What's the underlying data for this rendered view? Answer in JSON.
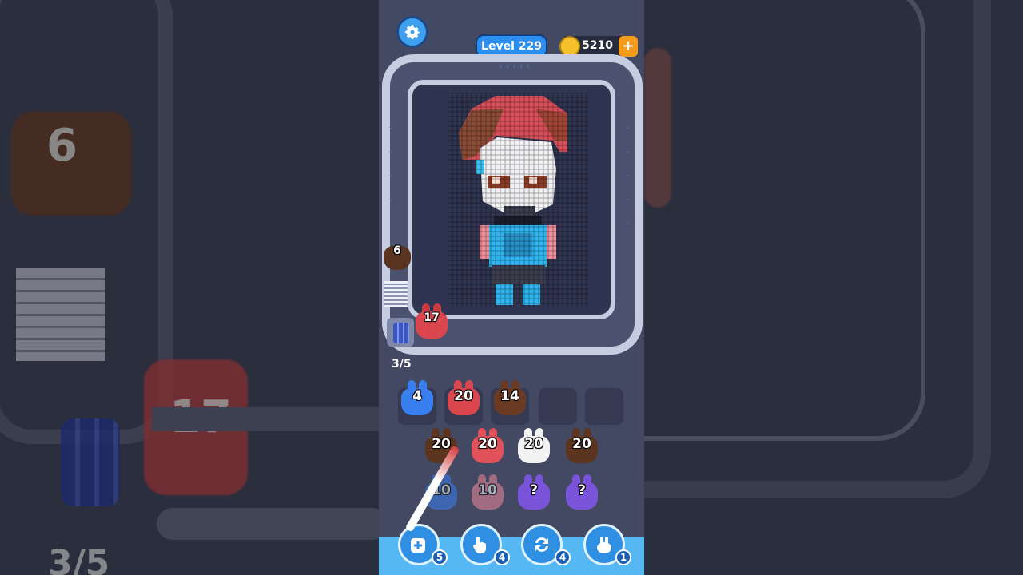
{
  "header": {
    "level_label": "Level 229",
    "coins": "5210",
    "coin_plus": "+"
  },
  "track": {
    "queue_item_count": "6",
    "active_item_count": "17",
    "slot_counter": "3/5"
  },
  "slots": [
    {
      "count": "4",
      "color": "#3a7ff0"
    },
    {
      "count": "20",
      "color": "#d9464d"
    },
    {
      "count": "14",
      "color": "#6a3b22"
    },
    {
      "count": "",
      "color": ""
    },
    {
      "count": "",
      "color": ""
    }
  ],
  "grid": {
    "row1": [
      {
        "count": "20",
        "color": "#5b3520"
      },
      {
        "count": "20",
        "color": "#e0515a"
      },
      {
        "count": "20",
        "color": "#f2f2f2"
      },
      {
        "count": "20",
        "color": "#5b3520"
      }
    ],
    "row2": [
      {
        "count": "10",
        "color": "#3a7ff0"
      },
      {
        "count": "10",
        "color": "#f0899a"
      },
      {
        "count": "?",
        "color": "#7a54d8"
      },
      {
        "count": "?",
        "color": "#7a54d8"
      }
    ]
  },
  "tools": [
    {
      "name": "add-slot",
      "badge": "5"
    },
    {
      "name": "hand",
      "badge": "4"
    },
    {
      "name": "shuffle",
      "badge": "4"
    },
    {
      "name": "bunny-magnet",
      "badge": "1"
    }
  ],
  "backdrop": {
    "left_count_top": "6",
    "left_count_mid": "17",
    "left_count_bottom": "3/5"
  },
  "colors": {
    "accent": "#2c8ef0",
    "coin": "#f5c12a",
    "track": "#c6cde0",
    "bottom_bar": "#55b8f3"
  }
}
